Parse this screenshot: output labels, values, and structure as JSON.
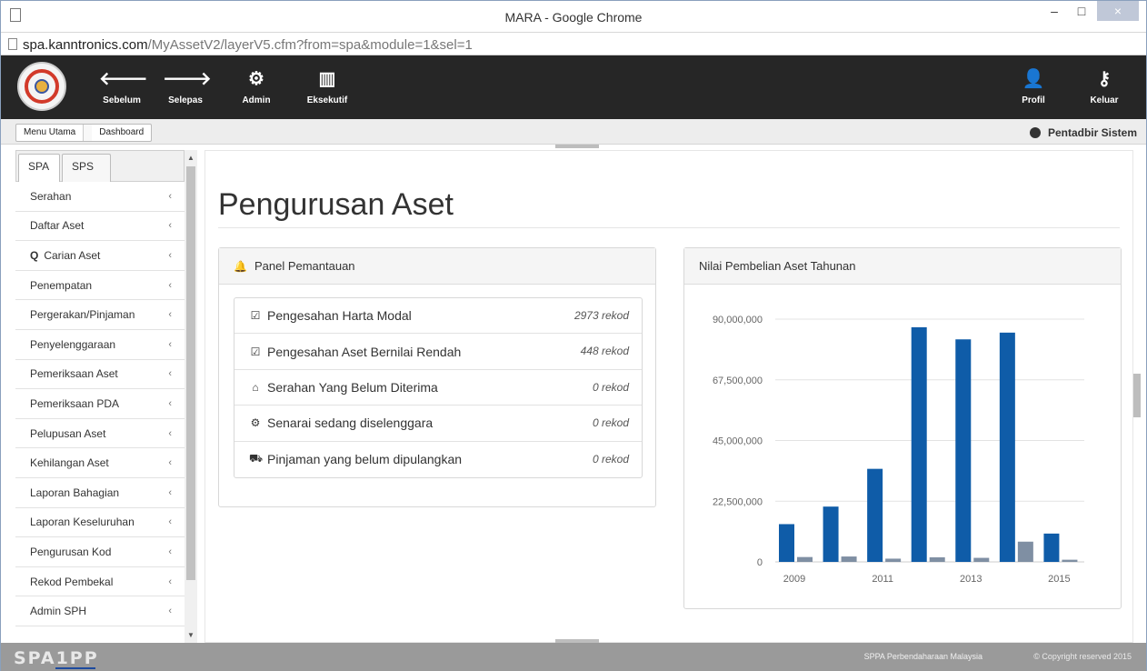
{
  "window": {
    "title": "MARA - Google Chrome",
    "controls": {
      "minimize": "–",
      "maximize": "□",
      "close": "×"
    }
  },
  "address": {
    "host": "spa.kanntronics.com",
    "path": "/MyAssetV2/layerV5.cfm?from=spa&module=1&sel=1"
  },
  "topnav": {
    "left": [
      {
        "label": "Sebelum",
        "icon": "arrow-left-icon",
        "glyph": "🡐"
      },
      {
        "label": "Selepas",
        "icon": "arrow-right-icon",
        "glyph": "🡒"
      },
      {
        "label": "Admin",
        "icon": "gears-icon",
        "glyph": "⚙"
      },
      {
        "label": "Eksekutif",
        "icon": "bar-chart-icon",
        "glyph": "▥"
      }
    ],
    "right": [
      {
        "label": "Profil",
        "icon": "user-icon",
        "glyph": "👤"
      },
      {
        "label": "Keluar",
        "icon": "key-icon",
        "glyph": "⚷"
      }
    ]
  },
  "breadcrumb": {
    "items": [
      "Menu Utama",
      "Dashboard"
    ]
  },
  "user": {
    "name": "Pentadbir Sistem"
  },
  "sidebar": {
    "tabs": [
      "SPA",
      "SPS"
    ],
    "items": [
      "Serahan",
      "Daftar Aset",
      "Carian Aset",
      "Penempatan",
      "Pergerakan/Pinjaman",
      "Penyelenggaraan",
      "Pemeriksaan Aset",
      "Pemeriksaan PDA",
      "Pelupusan Aset",
      "Kehilangan Aset",
      "Laporan Bahagian",
      "Laporan Keseluruhan",
      "Pengurusan Kod",
      "Rekod Pembekal",
      "Admin SPH"
    ],
    "chevron": "‹"
  },
  "main": {
    "title": "Pengurusan Aset",
    "monitor": {
      "heading": "Panel Pemantauan",
      "items": [
        {
          "label": "Pengesahan Harta Modal",
          "count": "2973 rekod",
          "glyph": "☑"
        },
        {
          "label": "Pengesahan Aset Bernilai Rendah",
          "count": "448 rekod",
          "glyph": "☑"
        },
        {
          "label": "Serahan Yang Belum Diterima",
          "count": "0 rekod",
          "glyph": "⌂"
        },
        {
          "label": "Senarai sedang diselenggara",
          "count": "0 rekod",
          "glyph": "⚙"
        },
        {
          "label": "Pinjaman yang belum dipulangkan",
          "count": "0 rekod",
          "glyph": "⛟"
        }
      ]
    },
    "chart_panel": {
      "heading": "Nilai Pembelian Aset Tahunan"
    }
  },
  "chart_data": {
    "type": "bar",
    "title": "Nilai Pembelian Aset Tahunan",
    "categories": [
      "2009",
      "2010",
      "2011",
      "2012",
      "2013",
      "2014",
      "2015"
    ],
    "xticks": [
      "2009",
      "2011",
      "2013",
      "2015"
    ],
    "series": [
      {
        "values": [
          14000000,
          20500000,
          34500000,
          87000000,
          82500000,
          85000000,
          10500000
        ],
        "color": "#0f5ca8"
      },
      {
        "values": [
          1800000,
          2000000,
          1200000,
          1700000,
          1500000,
          7500000,
          800000
        ],
        "color": "#7f8fa3"
      }
    ],
    "yticks": [
      "0",
      "22,500,000",
      "45,000,000",
      "67,500,000",
      "90,000,000"
    ],
    "ylim": [
      0,
      90000000
    ],
    "grid": true
  },
  "footer": {
    "brand": "SPA1PP",
    "org": "SPPA Perbendaharaan Malaysia",
    "copyright": "© Copyright reserved 2015"
  }
}
